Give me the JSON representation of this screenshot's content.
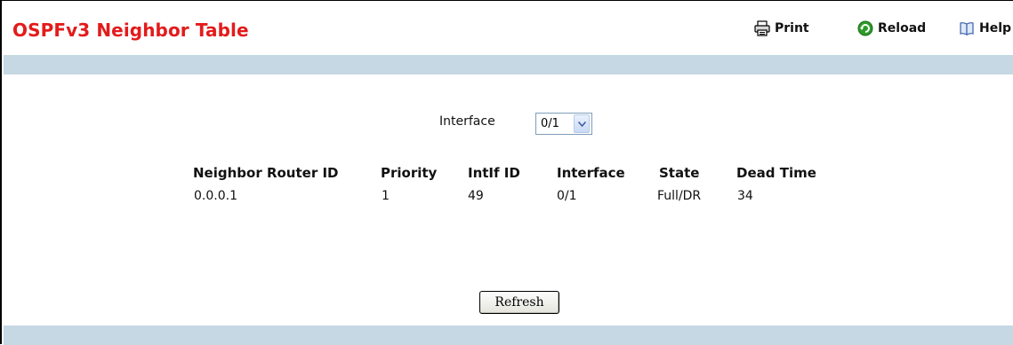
{
  "page": {
    "title": "OSPFv3 Neighbor Table"
  },
  "toolbar": {
    "print_label": "Print",
    "reload_label": "Reload",
    "help_label": "Help"
  },
  "filter": {
    "label": "Interface",
    "selected": "0/1"
  },
  "table": {
    "columns": [
      "Neighbor Router ID",
      "Priority",
      "IntIf ID",
      "Interface",
      "State",
      "Dead Time"
    ],
    "rows": [
      [
        "0.0.0.1",
        "1",
        "49",
        "0/1",
        "Full/DR",
        "34"
      ]
    ]
  },
  "actions": {
    "refresh_label": "Refresh"
  }
}
